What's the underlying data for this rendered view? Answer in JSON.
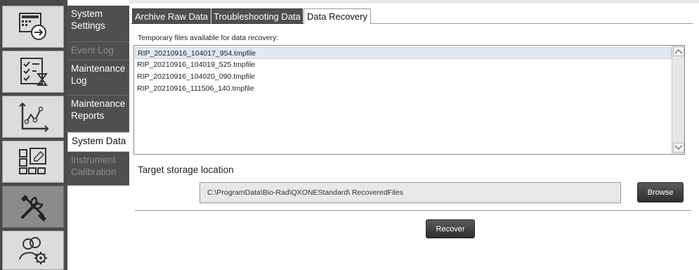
{
  "rail": {
    "items": [
      {
        "name": "export-icon"
      },
      {
        "name": "checklist-timer-icon"
      },
      {
        "name": "chart-line-icon"
      },
      {
        "name": "grid-edit-icon"
      },
      {
        "name": "tools-icon",
        "active": true
      },
      {
        "name": "users-settings-icon"
      }
    ]
  },
  "submenu": {
    "items": [
      {
        "label": "System Settings",
        "state": "normal"
      },
      {
        "label": "Event Log",
        "state": "disabled"
      },
      {
        "label": "Maintenance Log",
        "state": "normal"
      },
      {
        "label": "Maintenance Reports",
        "state": "normal"
      },
      {
        "label": "System Data",
        "state": "active"
      },
      {
        "label": "Instrument Calibration",
        "state": "disabled"
      }
    ]
  },
  "tabs": [
    {
      "label": "Archive Raw Data",
      "active": false
    },
    {
      "label": "Troubleshooting Data",
      "active": false
    },
    {
      "label": "Data Recovery",
      "active": true
    }
  ],
  "recovery": {
    "files_label": "Temporary files available for data recovery:",
    "files": [
      {
        "name": "RIP_20210916_104017_954.tmpfile",
        "selected": true
      },
      {
        "name": "RIP_20210916_104019_525.tmpfile",
        "selected": false
      },
      {
        "name": "RIP_20210916_104020_090.tmpfile",
        "selected": false
      },
      {
        "name": "RIP_20210916_111506_140.tmpfile",
        "selected": false
      }
    ],
    "target_label": "Target storage location",
    "target_path": "C:\\ProgramData\\Bio-Rad\\QXONEStandard\\ RecoveredFiles",
    "browse_label": "Browse",
    "recover_label": "Recover"
  },
  "colors": {
    "dark_panel": "#4f4f4f",
    "selected_row": "#dfe8f4",
    "button_dark": "#2e2e2e"
  }
}
